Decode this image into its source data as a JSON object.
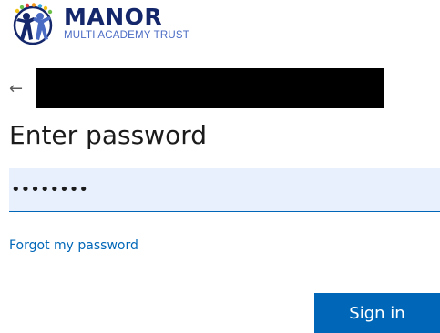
{
  "logo": {
    "name": "MANOR",
    "subtitle": "MULTI ACADEMY TRUST",
    "icon": "children-figures-logo",
    "colors": {
      "navy": "#15276b",
      "blue": "#4a6bc4",
      "yellow": "#f2c318",
      "green": "#6cc04a",
      "red": "#e23b3b",
      "orange": "#f39a1e",
      "cyan": "#3aa8e0"
    }
  },
  "identity": {
    "back_icon": "back-arrow-icon",
    "back_glyph": "←",
    "account_name": "",
    "redacted": true
  },
  "form": {
    "title": "Enter password",
    "password_value": "••••••••",
    "password_masked": "password",
    "forgot_label": "Forgot my password",
    "sign_in_label": "Sign in"
  },
  "colors": {
    "accent": "#0067b8",
    "input_background": "#e8f0fe",
    "text": "#1b1b1b"
  }
}
